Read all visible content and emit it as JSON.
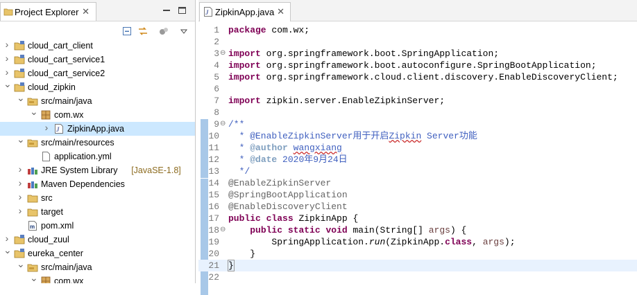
{
  "explorer": {
    "title": "Project Explorer",
    "items": [
      {
        "label": "cloud_cart_client",
        "decoration": "",
        "expanded": false,
        "depth": 0,
        "icon": "project-icon"
      },
      {
        "label": "cloud_cart_service1",
        "decoration": "",
        "expanded": false,
        "depth": 0,
        "icon": "project-icon"
      },
      {
        "label": "cloud_cart_service2",
        "decoration": "",
        "expanded": false,
        "depth": 0,
        "icon": "project-icon"
      },
      {
        "label": "cloud_zipkin",
        "decoration": "",
        "expanded": true,
        "depth": 0,
        "icon": "project-icon"
      },
      {
        "label": "src/main/java",
        "decoration": "",
        "expanded": true,
        "depth": 1,
        "icon": "source-folder-icon"
      },
      {
        "label": "com.wx",
        "decoration": "",
        "expanded": true,
        "depth": 2,
        "icon": "package-icon"
      },
      {
        "label": "ZipkinApp.java",
        "decoration": "",
        "expanded": false,
        "depth": 3,
        "icon": "java-file-icon",
        "selected": true
      },
      {
        "label": "src/main/resources",
        "decoration": "",
        "expanded": true,
        "depth": 1,
        "icon": "source-folder-icon"
      },
      {
        "label": "application.yml",
        "decoration": "",
        "expanded": null,
        "depth": 2,
        "icon": "file-icon"
      },
      {
        "label": "JRE System Library",
        "decoration": "[JavaSE-1.8]",
        "expanded": false,
        "depth": 1,
        "icon": "library-icon"
      },
      {
        "label": "Maven Dependencies",
        "decoration": "",
        "expanded": false,
        "depth": 1,
        "icon": "library-icon"
      },
      {
        "label": "src",
        "decoration": "",
        "expanded": false,
        "depth": 1,
        "icon": "folder-icon"
      },
      {
        "label": "target",
        "decoration": "",
        "expanded": false,
        "depth": 1,
        "icon": "folder-icon"
      },
      {
        "label": "pom.xml",
        "decoration": "",
        "expanded": null,
        "depth": 1,
        "icon": "maven-file-icon"
      },
      {
        "label": "cloud_zuul",
        "decoration": "",
        "expanded": false,
        "depth": 0,
        "icon": "project-icon"
      },
      {
        "label": "eureka_center",
        "decoration": "",
        "expanded": true,
        "depth": 0,
        "icon": "project-icon"
      },
      {
        "label": "src/main/java",
        "decoration": "",
        "expanded": true,
        "depth": 1,
        "icon": "source-folder-icon"
      },
      {
        "label": "com.wx",
        "decoration": "",
        "expanded": true,
        "depth": 2,
        "icon": "package-icon"
      }
    ]
  },
  "editor": {
    "tab": "ZipkinApp.java",
    "lines": [
      {
        "n": "1",
        "fold": "",
        "html": "<span class=\"kw\">package</span> com.wx;"
      },
      {
        "n": "2",
        "fold": "",
        "html": ""
      },
      {
        "n": "3",
        "fold": "⊖",
        "html": "<span class=\"kw\">import</span> org.springframework.boot.SpringApplication;"
      },
      {
        "n": "4",
        "fold": "",
        "html": "<span class=\"kw\">import</span> org.springframework.boot.autoconfigure.SpringBootApplication;"
      },
      {
        "n": "5",
        "fold": "",
        "html": "<span class=\"kw\">import</span> org.springframework.cloud.client.discovery.EnableDiscoveryClient;"
      },
      {
        "n": "6",
        "fold": "",
        "html": ""
      },
      {
        "n": "7",
        "fold": "",
        "html": "<span class=\"kw\">import</span> zipkin.server.EnableZipkinServer;"
      },
      {
        "n": "8",
        "fold": "",
        "html": ""
      },
      {
        "n": "9",
        "fold": "⊖",
        "html": "<span class=\"jd\">/**</span>"
      },
      {
        "n": "10",
        "fold": "",
        "html": "<span class=\"jd\">  * @EnableZipkinServer用于开启<span class=\"sq\">Zipkin</span> Server功能</span>"
      },
      {
        "n": "11",
        "fold": "",
        "html": "<span class=\"jd\">  * </span><span class=\"jt\">@author</span><span class=\"jd\"> <span class=\"sq\">wangxiang</span></span>"
      },
      {
        "n": "12",
        "fold": "",
        "html": "<span class=\"jd\">  * </span><span class=\"jt\">@date</span><span class=\"jd\"> 2020年9月24日</span>"
      },
      {
        "n": "13",
        "fold": "",
        "html": "<span class=\"jd\">  */</span>"
      },
      {
        "n": "14",
        "fold": "",
        "html": "<span class=\"an\">@EnableZipkinServer</span>"
      },
      {
        "n": "15",
        "fold": "",
        "html": "<span class=\"an\">@SpringBootApplication</span>"
      },
      {
        "n": "16",
        "fold": "",
        "html": "<span class=\"an\">@EnableDiscoveryClient</span>"
      },
      {
        "n": "17",
        "fold": "",
        "html": "<span class=\"kw\">public</span> <span class=\"kw\">class</span> ZipkinApp {"
      },
      {
        "n": "18",
        "fold": "⊖",
        "html": "    <span class=\"kw\">public</span> <span class=\"kw\">static</span> <span class=\"kw\">void</span> main(String[] <span style=\"color:#6a3e3e\">args</span>) {"
      },
      {
        "n": "19",
        "fold": "",
        "html": "        SpringApplication.<span class=\"it\">run</span>(ZipkinApp.<span class=\"kw\">class</span>, <span style=\"color:#6a3e3e\">args</span>);"
      },
      {
        "n": "20",
        "fold": "",
        "html": "    }"
      },
      {
        "n": "21",
        "fold": "",
        "html": "<span class=\"brk\">}</span>",
        "current": true
      },
      {
        "n": "22",
        "fold": "",
        "html": ""
      }
    ]
  },
  "colors": {
    "selection": "#cce8ff",
    "keyword": "#7f0055",
    "javadoc": "#3f5fbf",
    "annotation": "#646464",
    "current_line": "#e8f2fe"
  }
}
